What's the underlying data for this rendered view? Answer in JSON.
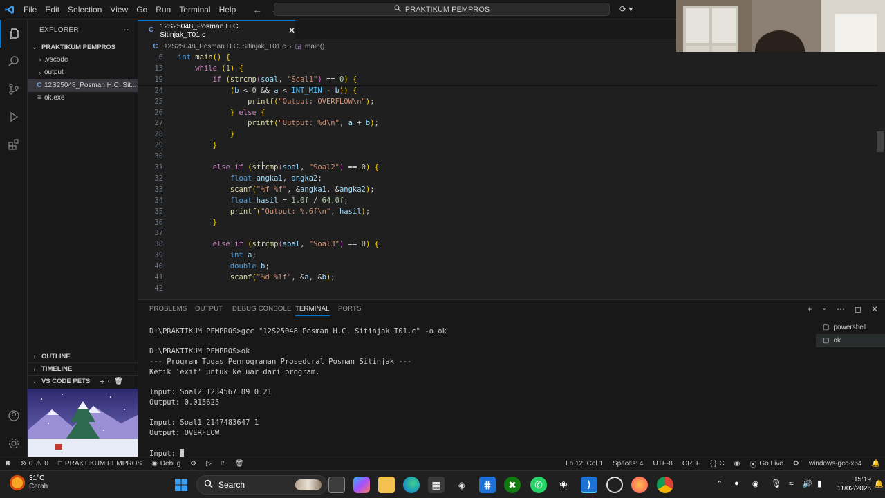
{
  "titlebar": {
    "menu": [
      "File",
      "Edit",
      "Selection",
      "View",
      "Go",
      "Run",
      "Terminal",
      "Help"
    ],
    "search_text": "PRAKTIKUM PEMPROS"
  },
  "sidebar": {
    "title": "EXPLORER",
    "root": "PRAKTIKUM PEMPROS",
    "items": [
      {
        "label": ".vscode"
      },
      {
        "label": "output"
      },
      {
        "label": "12S25048_Posman H.C. Sit..."
      },
      {
        "label": "ok.exe"
      }
    ],
    "outline": "OUTLINE",
    "timeline": "TIMELINE",
    "pets": "VS CODE PETS"
  },
  "editor": {
    "tab_label": "12S25048_Posman H.C. Sitinjak_T01.c",
    "breadcrumb_file": "12S25048_Posman H.C. Sitinjak_T01.c",
    "breadcrumb_symbol": "main()",
    "lines": [
      {
        "n": "6",
        "text": "int main() {"
      },
      {
        "n": "13",
        "text": "    while (1) {"
      },
      {
        "n": "19",
        "text": "        if (strcmp(soal, \"Soal1\") == 0) {"
      },
      {
        "n": "24",
        "text": "            (b < 0 && a < INT_MIN - b)) {"
      },
      {
        "n": "25",
        "text": "                printf(\"Output: OVERFLOW\\n\");"
      },
      {
        "n": "26",
        "text": "            } else {"
      },
      {
        "n": "27",
        "text": "                printf(\"Output: %d\\n\", a + b);"
      },
      {
        "n": "28",
        "text": "            }"
      },
      {
        "n": "29",
        "text": "        }"
      },
      {
        "n": "30",
        "text": ""
      },
      {
        "n": "31",
        "text": "        else if (strcmp(soal, \"Soal2\") == 0) {"
      },
      {
        "n": "32",
        "text": "            float angka1, angka2;"
      },
      {
        "n": "33",
        "text": "            scanf(\"%f %f\", &angka1, &angka2);"
      },
      {
        "n": "34",
        "text": "            float hasil = 1.0f / 64.0f;"
      },
      {
        "n": "35",
        "text": "            printf(\"Output: %.6f\\n\", hasil);"
      },
      {
        "n": "36",
        "text": "        }"
      },
      {
        "n": "37",
        "text": ""
      },
      {
        "n": "38",
        "text": "        else if (strcmp(soal, \"Soal3\") == 0) {"
      },
      {
        "n": "39",
        "text": "            int a;"
      },
      {
        "n": "40",
        "text": "            double b;"
      },
      {
        "n": "41",
        "text": "            scanf(\"%d %lf\", &a, &b);"
      },
      {
        "n": "42",
        "text": ""
      }
    ]
  },
  "panel": {
    "tabs": [
      "PROBLEMS",
      "OUTPUT",
      "DEBUG CONSOLE",
      "TERMINAL",
      "PORTS"
    ],
    "active_tab": "TERMINAL",
    "terminal_lines": [
      "D:\\PRAKTIKUM PEMPROS>gcc \"12S25048_Posman H.C. Sitinjak_T01.c\" -o ok",
      "",
      "D:\\PRAKTIKUM PEMPROS>ok",
      "--- Program Tugas Pemrograman Prosedural Posman Sitinjak ---",
      "Ketik 'exit' untuk keluar dari program.",
      "",
      "Input: Soal2 1234567.89 0.21",
      "Output: 0.015625",
      "",
      "Input: Soal1 2147483647 1",
      "Output: OVERFLOW",
      "",
      "Input: "
    ],
    "terminals": [
      "powershell",
      "ok"
    ]
  },
  "statusbar": {
    "errors": "0",
    "warnings": "0",
    "folder": "PRAKTIKUM PEMPROS",
    "debug": "Debug",
    "position": "Ln 12, Col 1",
    "spaces": "Spaces: 4",
    "encoding": "UTF-8",
    "eol": "CRLF",
    "language": "C",
    "golive": "Go Live",
    "config": "windows-gcc-x64"
  },
  "taskbar": {
    "weather_temp": "31°C",
    "weather_desc": "Cerah",
    "search": "Search",
    "time": "15:19",
    "date": "11/02/2026"
  },
  "colors": {
    "accent": "#0078d4",
    "editor_bg": "#1f1f1f",
    "chrome_bg": "#181818"
  }
}
